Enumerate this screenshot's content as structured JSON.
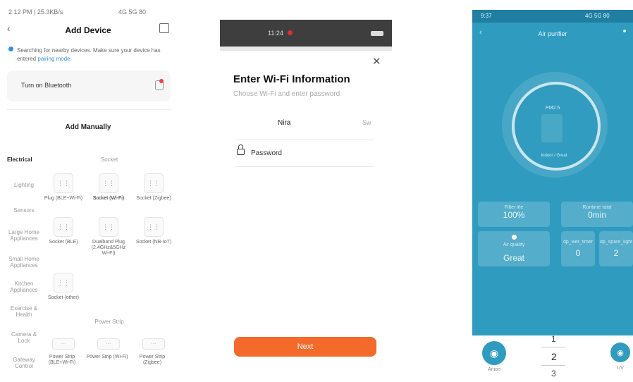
{
  "p1": {
    "status_time": "2:12 PM | 25.3KB/s",
    "status_right": "4G 5G 80",
    "back_icon": "chevron-left-icon",
    "title": "Add Device",
    "scan_icon": "scan-icon",
    "info_text": "Searching for nearby devices. Make sure your device has entered",
    "info_link": "pairing mode.",
    "bluetooth_label": "Turn on Bluetooth",
    "add_manually": "Add Manually",
    "categories": [
      "Electrical",
      "Lighting",
      "Sensors",
      "Large Home Appliances",
      "Small Home Appliances",
      "Kitchen Appliances",
      "Exercise & Health",
      "Camera & Lock",
      "Gateway Control"
    ],
    "section_socket": "Socket",
    "devices": [
      "Plug (BLE+Wi-Fi)",
      "Socket (Wi-Fi)",
      "Socket (Zigbee)",
      "Socket (BLE)",
      "Dualband Plug (2.4GHz&5GHz Wi-Fi)",
      "Socket (NB-IoT)",
      "Socket (other)"
    ],
    "section_power_strip": "Power Strip",
    "strips": [
      "Power Strip (BLE+Wi-Fi)",
      "Power Strip (Wi-Fi)",
      "Power Strip (Zigbee)"
    ]
  },
  "p2": {
    "status_time": "11:24",
    "close_icon": "close-icon",
    "title": "Enter Wi-Fi Information",
    "subtitle": "Choose Wi-Fi and enter password",
    "wifi_name": "Nira",
    "wifi_switch": "Sw",
    "password_placeholder": "Password",
    "next": "Next"
  },
  "p3": {
    "status_time": "9:37",
    "status_right": "4G 5G 80",
    "title": "Air purifier",
    "dial_value": "PM2.5",
    "dial_sub": "Indoor / Great",
    "filter_label": "Filter life",
    "filter_value": "100%",
    "runtime_label": "Runtime total",
    "runtime_value": "0min",
    "aq_label": "Air quality",
    "aq_value": "Great",
    "card4_label": "dp_wet_timer",
    "card4_value": "0",
    "card5_label": "dp_spare_light",
    "card5_value": "2",
    "nav_left": "Anion",
    "nav_right": "UV",
    "picker": [
      "1",
      "2",
      "3"
    ]
  },
  "colors": {
    "teal": "#2f9bbf",
    "orange": "#f46a2a"
  }
}
